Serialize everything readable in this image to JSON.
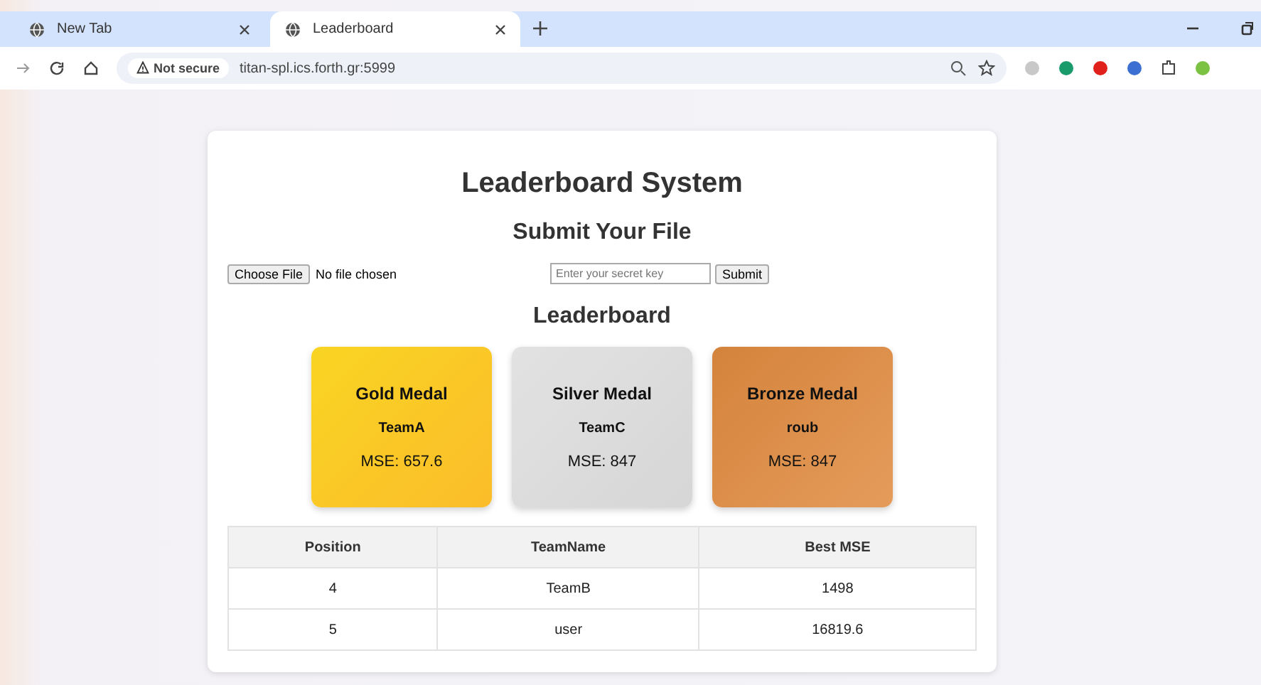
{
  "browser": {
    "tabs": [
      {
        "label": "New Tab",
        "selected": false
      },
      {
        "label": "Leaderboard",
        "selected": true
      }
    ],
    "security": "Not secure",
    "url": "titan-spl.ics.forth.gr:5999"
  },
  "page": {
    "title": "Leaderboard System",
    "submit_heading": "Submit Your File",
    "file_button": "Choose File",
    "file_status": "No file chosen",
    "key_placeholder": "Enter your secret key",
    "submit_button": "Submit",
    "leaderboard_heading": "Leaderboard",
    "medals": [
      {
        "kind": "gold",
        "title": "Gold Medal",
        "team": "TeamA",
        "score": "MSE: 657.6"
      },
      {
        "kind": "silver",
        "title": "Silver Medal",
        "team": "TeamC",
        "score": "MSE: 847"
      },
      {
        "kind": "bronze",
        "title": "Bronze Medal",
        "team": "roub",
        "score": "MSE: 847"
      }
    ],
    "table": {
      "columns": [
        "Position",
        "TeamName",
        "Best MSE"
      ],
      "rows": [
        [
          "4",
          "TeamB",
          "1498"
        ],
        [
          "5",
          "user",
          "16819.6"
        ]
      ]
    }
  }
}
